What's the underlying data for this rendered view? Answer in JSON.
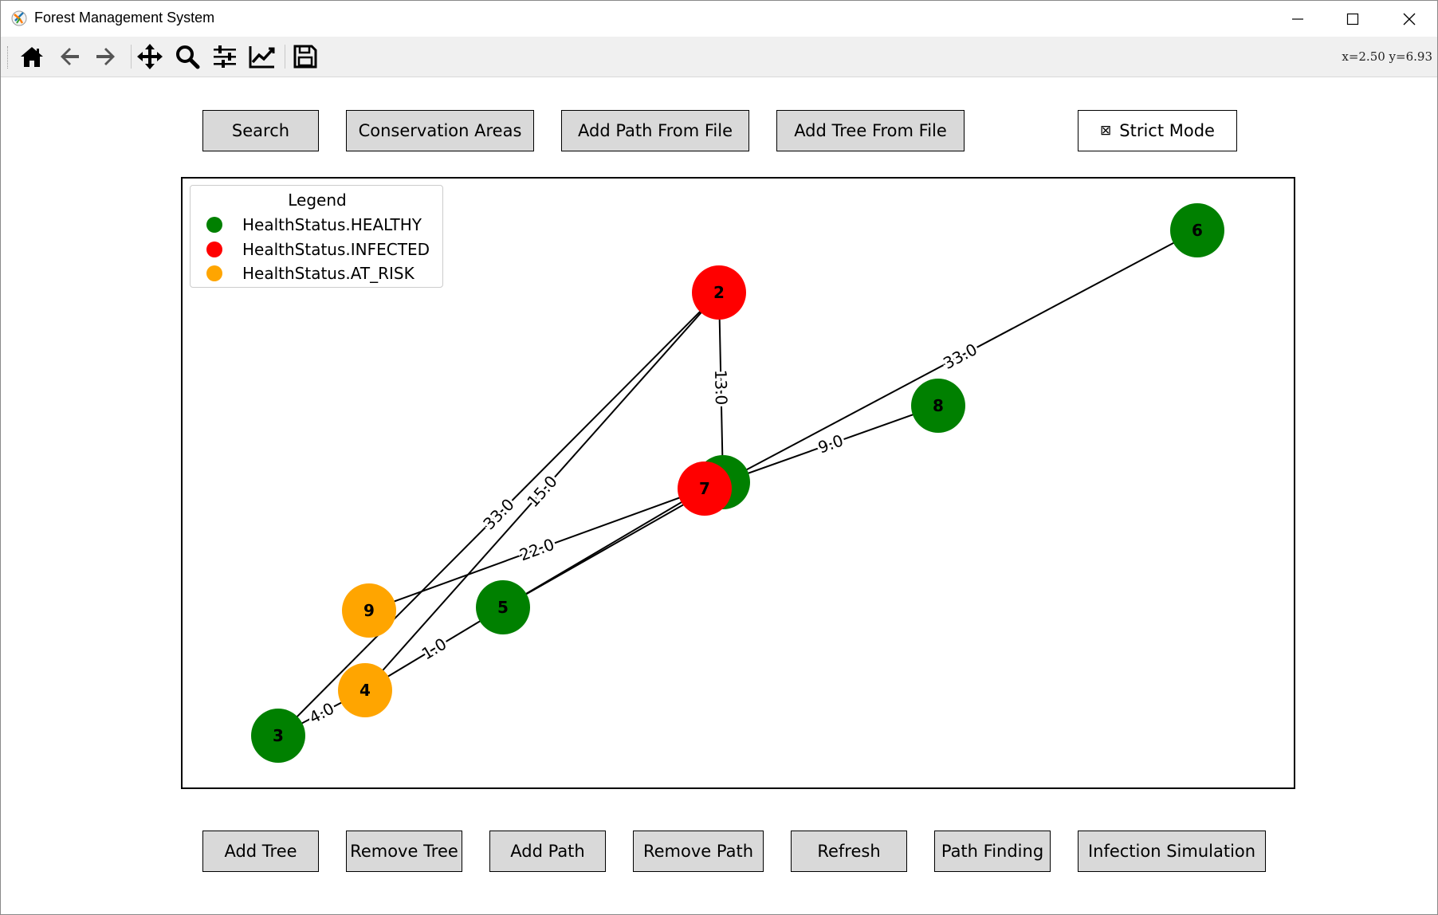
{
  "window": {
    "title": "Forest Management System"
  },
  "toolbar": {
    "tools": [
      "home-icon",
      "back-icon",
      "forward-icon",
      "pan-icon",
      "zoom-icon",
      "configure-subplots-icon",
      "edit-axis-icon",
      "save-icon"
    ],
    "coords": "x=2.50  y=6.93"
  },
  "top_buttons": {
    "search": "Search",
    "conservation": "Conservation Areas",
    "add_path_file": "Add Path From File",
    "add_tree_file": "Add Tree From File",
    "strict_mode": "Strict Mode",
    "strict_mode_glyph": "⊠"
  },
  "bottom_buttons": {
    "add_tree": "Add Tree",
    "remove_tree": "Remove Tree",
    "add_path": "Add Path",
    "remove_path": "Remove Path",
    "refresh": "Refresh",
    "path_finding": "Path Finding",
    "infection": "Infection Simulation"
  },
  "legend": {
    "title": "Legend",
    "items": [
      {
        "label": "HealthStatus.HEALTHY",
        "color": "#008000"
      },
      {
        "label": "HealthStatus.INFECTED",
        "color": "#ff0000"
      },
      {
        "label": "HealthStatus.AT_RISK",
        "color": "#ffa500"
      }
    ]
  },
  "graph": {
    "nodes": [
      {
        "id": "1",
        "status": "HEALTHY"
      },
      {
        "id": "2",
        "status": "INFECTED"
      },
      {
        "id": "3",
        "status": "HEALTHY"
      },
      {
        "id": "4",
        "status": "AT_RISK"
      },
      {
        "id": "5",
        "status": "HEALTHY"
      },
      {
        "id": "6",
        "status": "HEALTHY"
      },
      {
        "id": "7",
        "status": "INFECTED"
      },
      {
        "id": "8",
        "status": "HEALTHY"
      },
      {
        "id": "9",
        "status": "AT_RISK"
      }
    ],
    "edges": [
      {
        "from": "2",
        "to": "1",
        "label": "13.0"
      },
      {
        "from": "1",
        "to": "6",
        "label": "33.0"
      },
      {
        "from": "1",
        "to": "8",
        "label": "9.0"
      },
      {
        "from": "2",
        "to": "3",
        "label": "33.0"
      },
      {
        "from": "2",
        "to": "4",
        "label": "15.0"
      },
      {
        "from": "9",
        "to": "7",
        "label": "22.0"
      },
      {
        "from": "3",
        "to": "4",
        "label": "4.0"
      },
      {
        "from": "4",
        "to": "5",
        "label": "1.0"
      },
      {
        "from": "5",
        "to": "1",
        "label": ""
      },
      {
        "from": "5",
        "to": "7",
        "label": ""
      }
    ],
    "status_colors": {
      "HEALTHY": "#008000",
      "INFECTED": "#ff0000",
      "AT_RISK": "#ffa500"
    }
  }
}
